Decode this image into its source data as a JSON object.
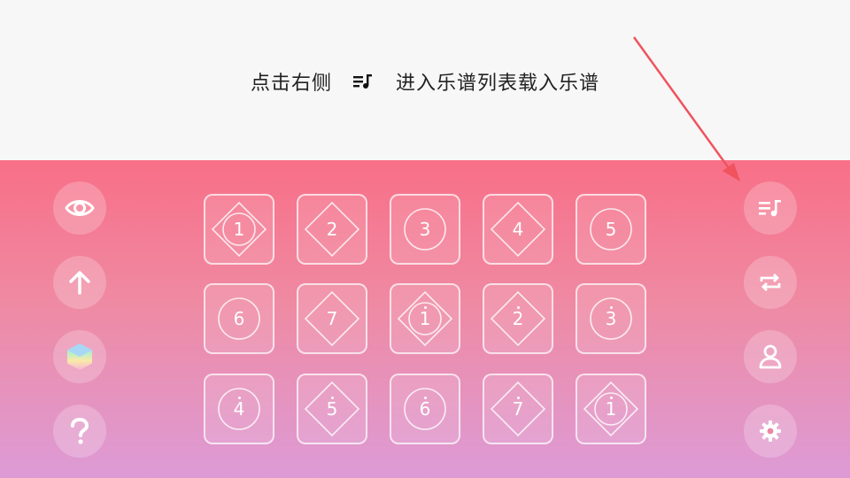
{
  "hint": {
    "prefix": "点击右侧",
    "suffix": "进入乐谱列表载入乐谱",
    "icon": "playlist-music-icon"
  },
  "left_toolbar": [
    {
      "name": "eye-icon"
    },
    {
      "name": "arrow-up-icon"
    },
    {
      "name": "hexagon-color-icon"
    },
    {
      "name": "question-icon"
    }
  ],
  "right_toolbar": [
    {
      "name": "playlist-music-icon"
    },
    {
      "name": "repeat-icon"
    },
    {
      "name": "user-icon"
    },
    {
      "name": "gear-icon"
    }
  ],
  "keys": [
    {
      "label": "1",
      "shape": "diamond-circle",
      "dot": ""
    },
    {
      "label": "2",
      "shape": "diamond",
      "dot": ""
    },
    {
      "label": "3",
      "shape": "circle",
      "dot": ""
    },
    {
      "label": "4",
      "shape": "diamond",
      "dot": ""
    },
    {
      "label": "5",
      "shape": "circle",
      "dot": ""
    },
    {
      "label": "6",
      "shape": "circle",
      "dot": ""
    },
    {
      "label": "7",
      "shape": "diamond",
      "dot": ""
    },
    {
      "label": "1",
      "shape": "diamond-circle",
      "dot": "above"
    },
    {
      "label": "2",
      "shape": "diamond",
      "dot": "above"
    },
    {
      "label": "3",
      "shape": "circle",
      "dot": "above"
    },
    {
      "label": "4",
      "shape": "circle",
      "dot": "above"
    },
    {
      "label": "5",
      "shape": "diamond",
      "dot": "above"
    },
    {
      "label": "6",
      "shape": "circle",
      "dot": "above"
    },
    {
      "label": "7",
      "shape": "diamond",
      "dot": "above"
    },
    {
      "label": "1",
      "shape": "diamond-circle",
      "dot": "above2"
    }
  ],
  "colors": {
    "stage_top": "#f86f87",
    "stage_bottom": "#dd9bd6",
    "arrow": "#f0535e"
  }
}
